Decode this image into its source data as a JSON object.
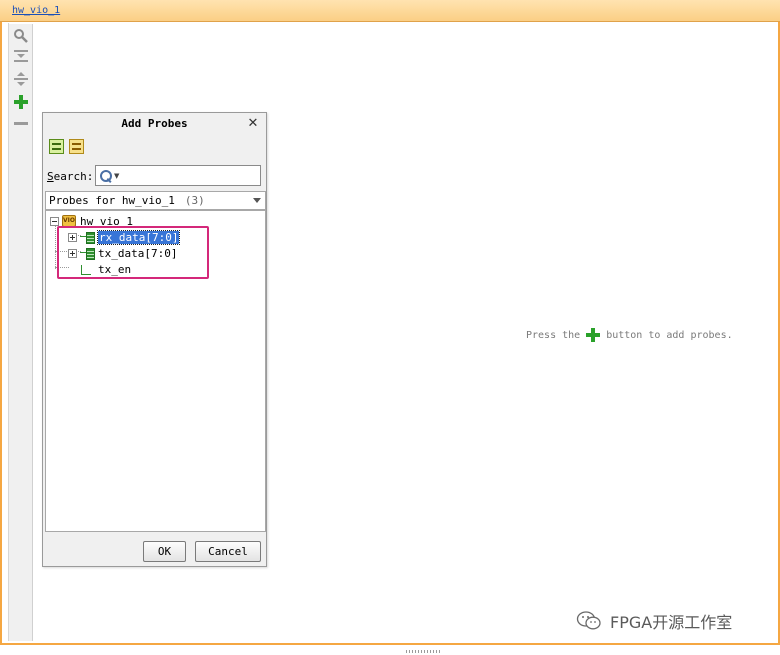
{
  "window": {
    "tab_title": "hw_vio_1",
    "accent_color": "#f5a742"
  },
  "toolbar": {
    "items": [
      {
        "icon": "search-icon"
      },
      {
        "icon": "collapse-all-icon"
      },
      {
        "icon": "expand-all-icon"
      },
      {
        "icon": "add-icon"
      },
      {
        "icon": "remove-icon"
      }
    ]
  },
  "main": {
    "hint_before": "Press the",
    "hint_after": "button to add probes."
  },
  "dialog": {
    "title": "Add Probes",
    "close_glyph": "✕",
    "search_label_prefix": "S",
    "search_label_rest": "earch:",
    "search_value": "",
    "probes_for_label": "Probes for hw_vio_1",
    "probes_count": "(3)",
    "tree": {
      "root": "hw_vio_1",
      "root_icon_text": "VIO",
      "children": [
        {
          "label": "rx_data[7:0]",
          "selected": true
        },
        {
          "label": "tx_data[7:0]",
          "selected": false
        },
        {
          "label": "tx_en",
          "selected": false
        }
      ]
    },
    "ok_label": "OK",
    "cancel_label": "Cancel"
  },
  "watermark": {
    "text": "FPGA开源工作室"
  }
}
